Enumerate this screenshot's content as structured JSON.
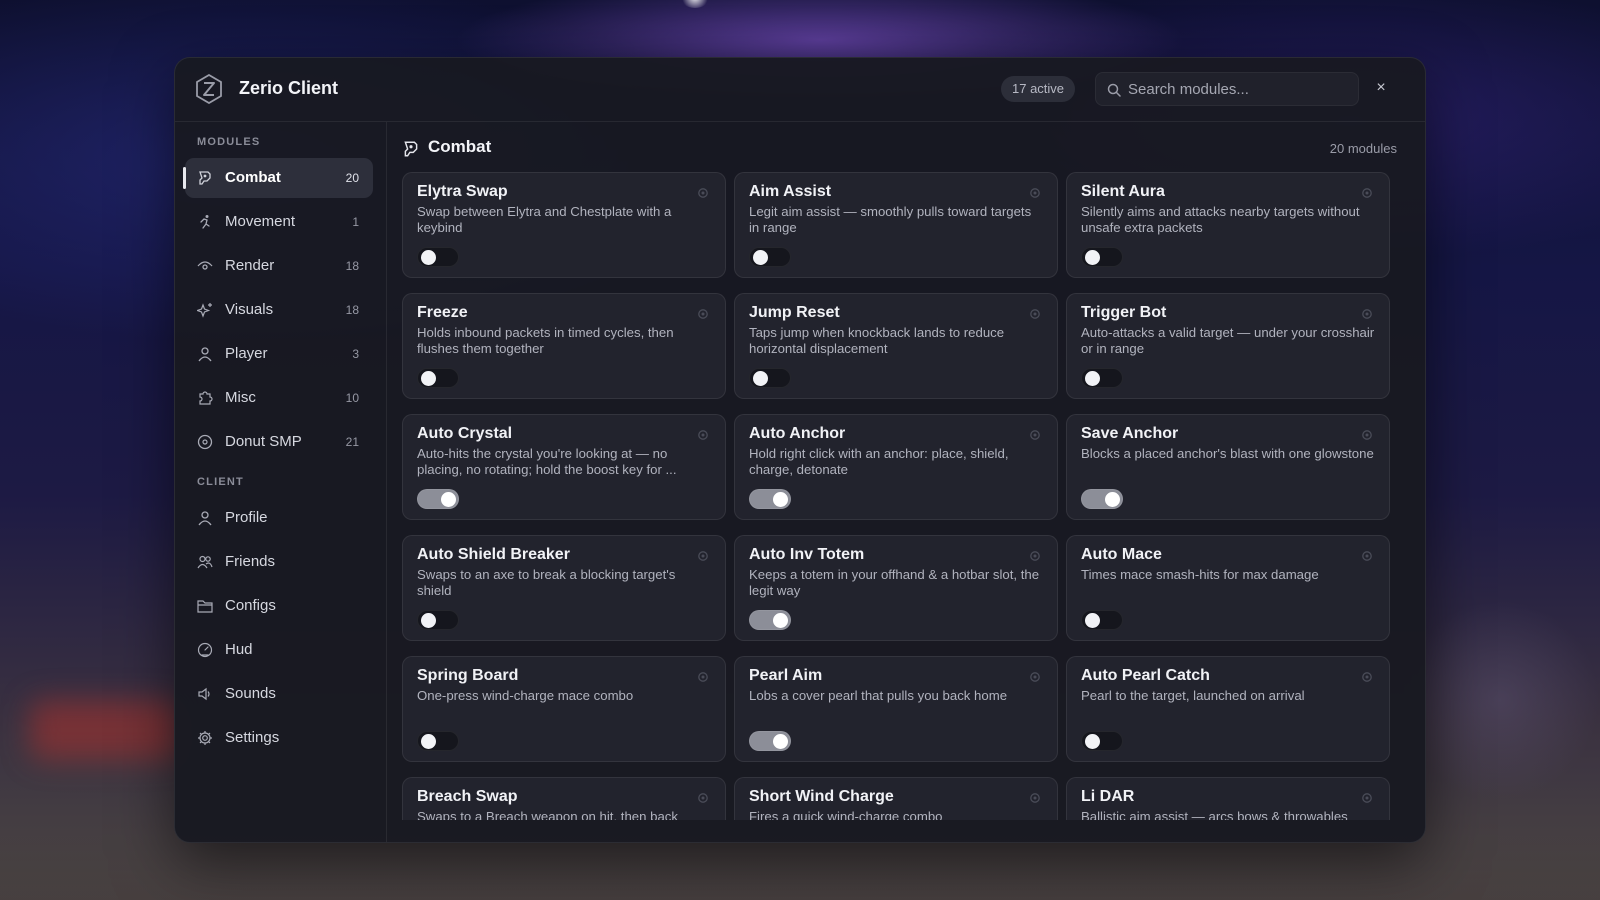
{
  "app": {
    "title": "Zerio Client",
    "active_count": "17 active"
  },
  "search": {
    "placeholder": "Search modules..."
  },
  "close_label": "×",
  "sidebar": {
    "modules_label": "MODULES",
    "modules": [
      {
        "label": "Combat",
        "count": "20",
        "icon": "sword-icon",
        "active": true
      },
      {
        "label": "Movement",
        "count": "1",
        "icon": "running-icon"
      },
      {
        "label": "Render",
        "count": "18",
        "icon": "eye-icon"
      },
      {
        "label": "Visuals",
        "count": "18",
        "icon": "sparkle-icon"
      },
      {
        "label": "Player",
        "count": "3",
        "icon": "user-icon"
      },
      {
        "label": "Misc",
        "count": "10",
        "icon": "puzzle-icon"
      },
      {
        "label": "Donut SMP",
        "count": "21",
        "icon": "donut-icon"
      }
    ],
    "client_label": "CLIENT",
    "client": [
      {
        "label": "Profile",
        "icon": "user-icon"
      },
      {
        "label": "Friends",
        "icon": "users-icon"
      },
      {
        "label": "Configs",
        "icon": "folder-icon"
      },
      {
        "label": "Hud",
        "icon": "gauge-icon"
      },
      {
        "label": "Sounds",
        "icon": "speaker-icon"
      },
      {
        "label": "Settings",
        "icon": "gear-icon"
      }
    ]
  },
  "main": {
    "title": "Combat",
    "module_count": "20 modules",
    "cards": [
      {
        "name": "Elytra Swap",
        "desc": "Swap between Elytra and Chestplate with a keybind",
        "enabled": false
      },
      {
        "name": "Aim Assist",
        "desc": "Legit aim assist — smoothly pulls toward targets in range",
        "enabled": false
      },
      {
        "name": "Silent Aura",
        "desc": "Silently aims and attacks nearby targets without unsafe extra packets",
        "enabled": false
      },
      {
        "name": "Freeze",
        "desc": "Holds inbound packets in timed cycles, then flushes them together",
        "enabled": false
      },
      {
        "name": "Jump Reset",
        "desc": "Taps jump when knockback lands to reduce horizontal displacement",
        "enabled": false
      },
      {
        "name": "Trigger Bot",
        "desc": "Auto-attacks a valid target — under your crosshair or in range",
        "enabled": false
      },
      {
        "name": "Auto Crystal",
        "desc": "Auto-hits the crystal you're looking at — no placing, no rotating; hold the boost key for ...",
        "enabled": true
      },
      {
        "name": "Auto Anchor",
        "desc": "Hold right click with an anchor: place, shield, charge, detonate",
        "enabled": true
      },
      {
        "name": "Save Anchor",
        "desc": "Blocks a placed anchor's blast with one glowstone",
        "enabled": true
      },
      {
        "name": "Auto Shield Breaker",
        "desc": "Swaps to an axe to break a blocking target's shield",
        "enabled": false
      },
      {
        "name": "Auto Inv Totem",
        "desc": "Keeps a totem in your offhand & a hotbar slot, the legit way",
        "enabled": true
      },
      {
        "name": "Auto Mace",
        "desc": "Times mace smash-hits for max damage",
        "enabled": false
      },
      {
        "name": "Spring Board",
        "desc": "One-press wind-charge mace combo",
        "enabled": false
      },
      {
        "name": "Pearl Aim",
        "desc": "Lobs a cover pearl that pulls you back home",
        "enabled": true
      },
      {
        "name": "Auto Pearl Catch",
        "desc": "Pearl to the target, launched on arrival",
        "enabled": false
      },
      {
        "name": "Breach Swap",
        "desc": "Swaps to a Breach weapon on hit, then back",
        "enabled": false
      },
      {
        "name": "Short Wind Charge",
        "desc": "Fires a quick wind-charge combo",
        "enabled": false
      },
      {
        "name": "Li DAR",
        "desc": "Ballistic aim assist — arcs bows & throwables onto targets",
        "enabled": false
      }
    ]
  }
}
